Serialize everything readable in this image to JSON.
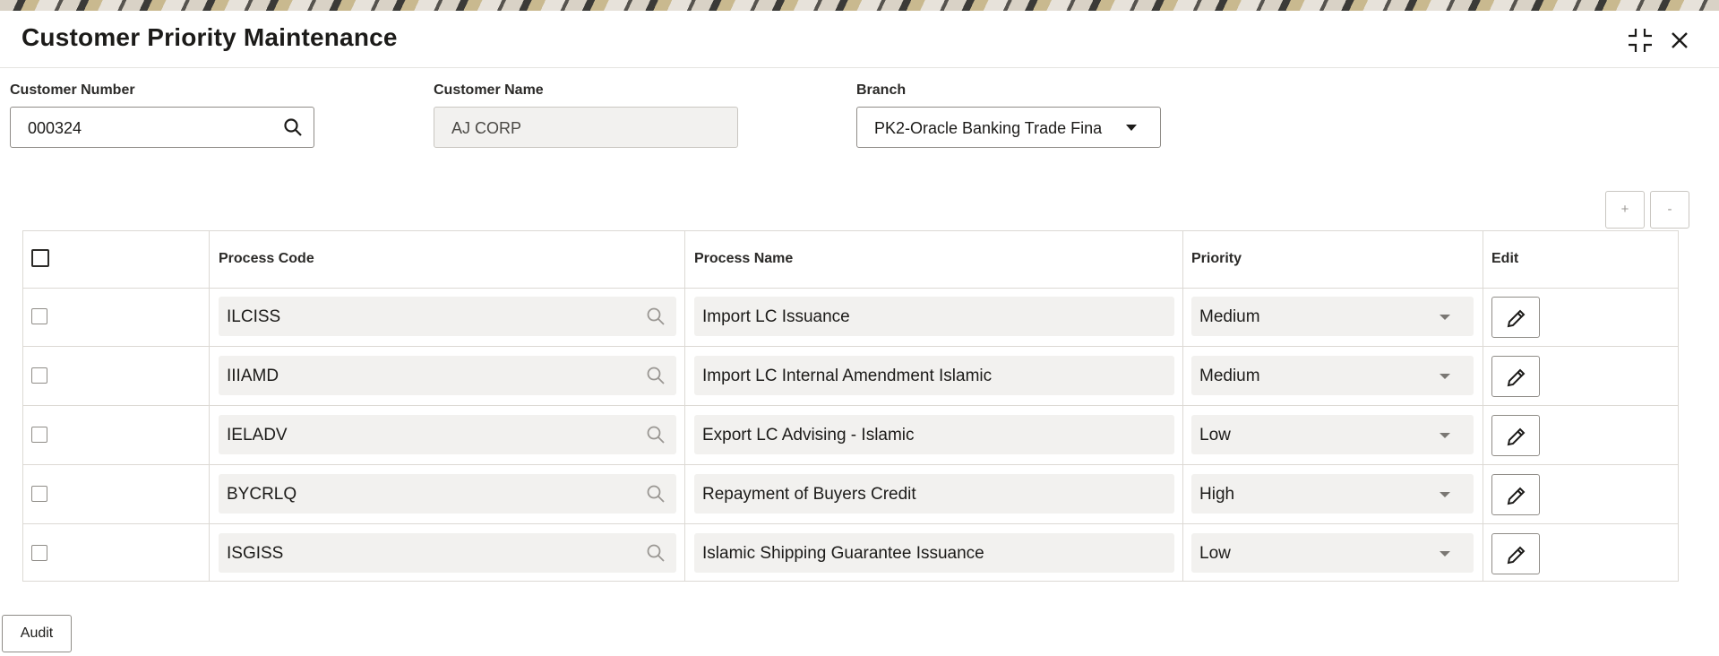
{
  "window": {
    "title": "Customer Priority Maintenance",
    "icons": [
      "collapse-icon",
      "close-icon"
    ]
  },
  "form": {
    "customer_number": {
      "label": "Customer Number",
      "value": "000324"
    },
    "customer_name": {
      "label": "Customer Name",
      "value": "AJ CORP"
    },
    "branch": {
      "label": "Branch",
      "value": "PK2-Oracle Banking Trade Fina"
    }
  },
  "grid_actions": {
    "add_label": "+",
    "remove_label": "-"
  },
  "table": {
    "headers": [
      "Process Code",
      "Process Name",
      "Priority",
      "Edit"
    ],
    "rows": [
      {
        "code": "ILCISS",
        "name": "Import LC Issuance",
        "priority": "Medium"
      },
      {
        "code": "IIIAMD",
        "name": "Import LC Internal Amendment Islamic",
        "priority": "Medium"
      },
      {
        "code": "IELADV",
        "name": "Export LC Advising - Islamic",
        "priority": "Low"
      },
      {
        "code": "BYCRLQ",
        "name": "Repayment of Buyers Credit",
        "priority": "High"
      },
      {
        "code": "ISGISS",
        "name": "Islamic Shipping Guarantee Issuance",
        "priority": "Low"
      }
    ]
  },
  "footer": {
    "audit_label": "Audit"
  }
}
